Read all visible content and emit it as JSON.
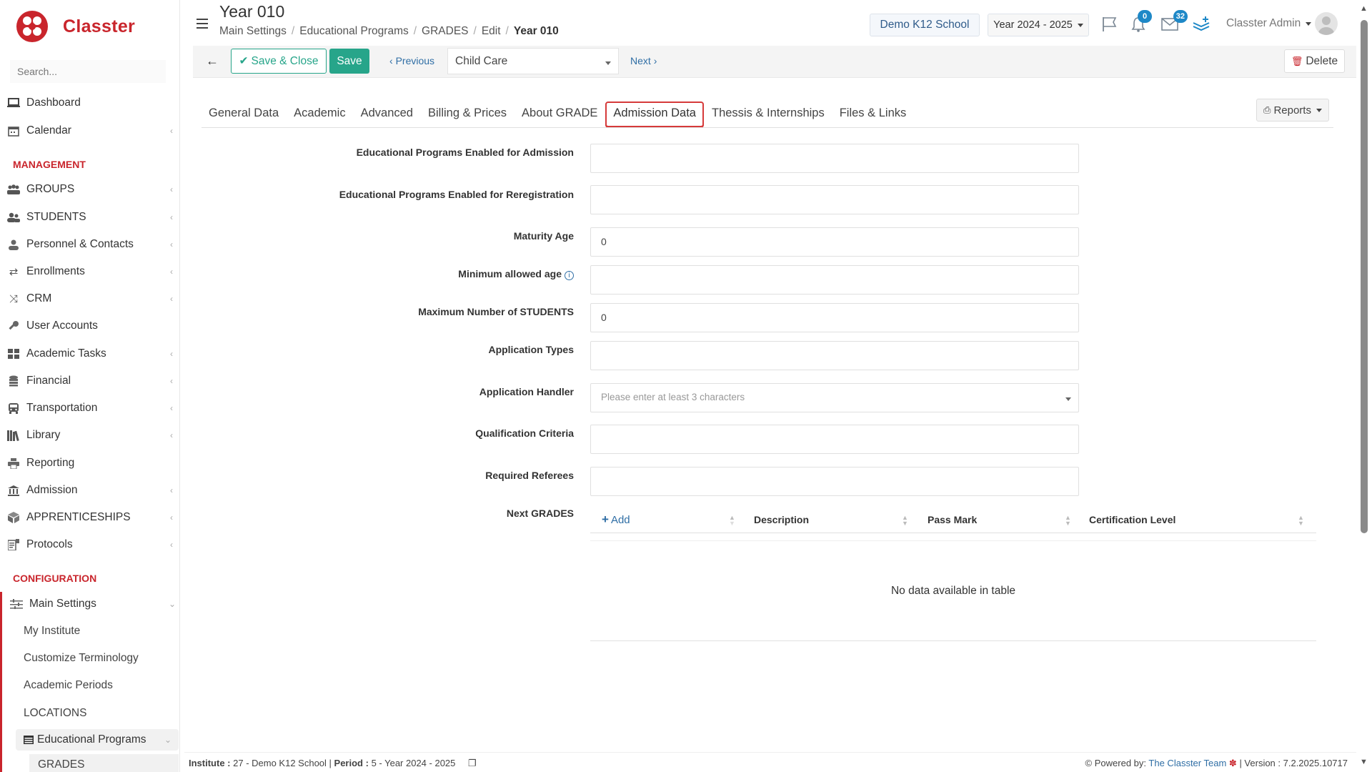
{
  "app": {
    "name": "Classter"
  },
  "sidebar": {
    "search_placeholder": "Search...",
    "top_items": [
      {
        "label": "Dashboard",
        "icon": "laptop-icon"
      },
      {
        "label": "Calendar",
        "icon": "calendar-icon"
      }
    ],
    "management_title": "MANAGEMENT",
    "management_items": [
      {
        "label": "GROUPS",
        "icon": "groups-icon"
      },
      {
        "label": "STUDENTS",
        "icon": "students-icon"
      },
      {
        "label": "Personnel & Contacts",
        "icon": "person-icon"
      },
      {
        "label": "Enrollments",
        "icon": "swap-icon"
      },
      {
        "label": "CRM",
        "icon": "shuffle-icon"
      },
      {
        "label": "User Accounts",
        "icon": "key-icon"
      },
      {
        "label": "Academic Tasks",
        "icon": "grid-icon"
      },
      {
        "label": "Financial",
        "icon": "coins-icon"
      },
      {
        "label": "Transportation",
        "icon": "bus-icon"
      },
      {
        "label": "Library",
        "icon": "books-icon"
      },
      {
        "label": "Reporting",
        "icon": "print-icon"
      },
      {
        "label": "Admission",
        "icon": "building-icon"
      },
      {
        "label": "APPRENTICESHIPS",
        "icon": "box-icon"
      },
      {
        "label": "Protocols",
        "icon": "protocol-icon"
      }
    ],
    "configuration_title": "CONFIGURATION",
    "main_settings": {
      "label": "Main Settings",
      "icon": "sliders-icon"
    },
    "main_settings_children": [
      {
        "label": "My Institute"
      },
      {
        "label": "Customize Terminology"
      },
      {
        "label": "Academic Periods"
      },
      {
        "label": "LOCATIONS"
      }
    ],
    "edu_programs": {
      "label": "Educational Programs",
      "icon": "table-icon"
    },
    "grades": {
      "label": "GRADES"
    }
  },
  "header": {
    "title": "Year 010",
    "breadcrumb": [
      "Main Settings",
      "Educational Programs",
      "GRADES",
      "Edit"
    ],
    "breadcrumb_current": "Year 010",
    "school": "Demo K12 School",
    "year": "Year 2024 - 2025",
    "notifications_count": "0",
    "messages_count": "32",
    "user": "Classter Admin"
  },
  "toolbar": {
    "save_close": "Save & Close",
    "save": "Save",
    "previous": "Previous",
    "selected_program": "Child Care",
    "next": "Next",
    "delete": "Delete"
  },
  "tabs": [
    "General Data",
    "Academic",
    "Advanced",
    "Billing & Prices",
    "About GRADE",
    "Admission Data",
    "Thessis & Internships",
    "Files & Links"
  ],
  "active_tab": "Admission Data",
  "reports": "Reports",
  "form": {
    "programs_admission": {
      "label": "Educational Programs Enabled for Admission",
      "value": ""
    },
    "programs_reregistration": {
      "label": "Educational Programs Enabled for Reregistration",
      "value": ""
    },
    "maturity_age": {
      "label": "Maturity Age",
      "value": "0"
    },
    "min_age": {
      "label": "Minimum allowed age",
      "value": ""
    },
    "max_students": {
      "label": "Maximum Number of STUDENTS",
      "value": "0"
    },
    "application_types": {
      "label": "Application Types",
      "value": ""
    },
    "application_handler": {
      "label": "Application Handler",
      "placeholder": "Please enter at least 3 characters"
    },
    "qualification_criteria": {
      "label": "Qualification Criteria",
      "value": ""
    },
    "required_referees": {
      "label": "Required Referees",
      "value": ""
    },
    "next_grades": {
      "label": "Next GRADES"
    }
  },
  "table": {
    "add": "Add",
    "columns": [
      "Description",
      "Pass Mark",
      "Certification Level"
    ],
    "empty": "No data available in table"
  },
  "footer": {
    "institute_label": "Institute :",
    "institute_value": "27 - Demo K12 School",
    "period_label": "Period :",
    "period_value": "5 - Year 2024 - 2025",
    "powered_label": "Powered by:",
    "powered_link": "The Classter Team",
    "version": "| Version : 7.2.2025.10717"
  },
  "colors": {
    "brand": "#c9252c",
    "accent": "#27a58a",
    "link": "#2f6ea5",
    "badge": "#1e88c7"
  }
}
